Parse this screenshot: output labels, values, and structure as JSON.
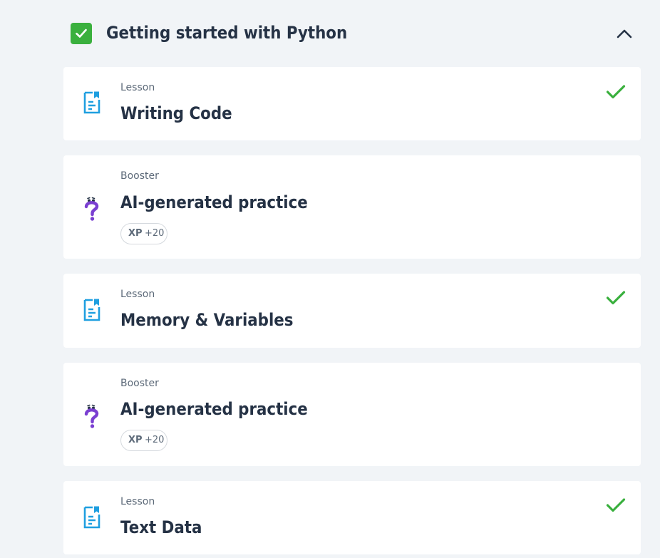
{
  "section": {
    "title": "Getting started with Python",
    "completed": true,
    "expanded": true
  },
  "colors": {
    "background": "#f1f4f7",
    "card": "#ffffff",
    "success_green": "#3ab03e",
    "lesson_icon_blue": "#1f9fe0",
    "booster_icon_purple": "#7a3fd1",
    "title_text": "#253245",
    "meta_text": "#5d6a79"
  },
  "items": [
    {
      "type": "Lesson",
      "title": "Writing Code",
      "icon": "lesson-document-icon",
      "completed": true
    },
    {
      "type": "Booster",
      "title": "AI-generated practice",
      "icon": "question-mark-character-icon",
      "xp_label": "XP",
      "xp_value": "+20",
      "completed": false
    },
    {
      "type": "Lesson",
      "title": "Memory & Variables",
      "icon": "lesson-document-icon",
      "completed": true
    },
    {
      "type": "Booster",
      "title": "AI-generated practice",
      "icon": "question-mark-character-icon",
      "xp_label": "XP",
      "xp_value": "+20",
      "completed": false
    },
    {
      "type": "Lesson",
      "title": "Text Data",
      "icon": "lesson-document-icon",
      "completed": true
    }
  ]
}
